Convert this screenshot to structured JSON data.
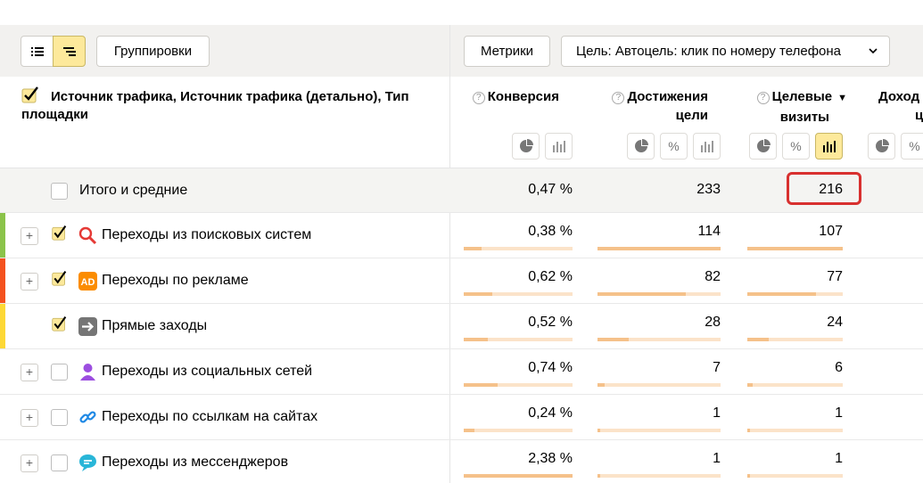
{
  "toolbar": {
    "groupings_label": "Группировки",
    "metrics_label": "Метрики",
    "goal_label": "Цель: Автоцель: клик по номеру телефона"
  },
  "header": {
    "dimension_title": "Источник трафика, Источник трафика (детально), Тип площадки",
    "columns": [
      {
        "label_line1": "Конверсия",
        "label_line2": ""
      },
      {
        "label_line1": "Достижения",
        "label_line2": "цели"
      },
      {
        "label_line1": "Целевые",
        "label_line2": "визиты",
        "sorted": "▼"
      },
      {
        "label_line1": "Доход",
        "label_line2": "ц"
      }
    ]
  },
  "total": {
    "label": "Итого и средние",
    "conversion": "0,47 %",
    "achievements": "233",
    "target_visits": "216"
  },
  "rows": [
    {
      "label": "Переходы из поисковых систем",
      "conversion": "0,38 %",
      "achievements": "114",
      "target_visits": "107",
      "stripe": "#8bc34a",
      "checked": true,
      "expandable": true,
      "icon": "search-icon",
      "conv_fill": 0.16,
      "ach_fill": 1.0,
      "tv_fill": 1.0
    },
    {
      "label": "Переходы по рекламе",
      "conversion": "0,62 %",
      "achievements": "82",
      "target_visits": "77",
      "stripe": "#f4511e",
      "checked": true,
      "expandable": true,
      "icon": "ad-icon",
      "conv_fill": 0.26,
      "ach_fill": 0.72,
      "tv_fill": 0.72
    },
    {
      "label": "Прямые заходы",
      "conversion": "0,52 %",
      "achievements": "28",
      "target_visits": "24",
      "stripe": "#fdd835",
      "checked": true,
      "expandable": false,
      "icon": "direct-arrow-icon",
      "conv_fill": 0.22,
      "ach_fill": 0.25,
      "tv_fill": 0.22
    },
    {
      "label": "Переходы из социальных сетей",
      "conversion": "0,74 %",
      "achievements": "7",
      "target_visits": "6",
      "stripe": "",
      "checked": false,
      "expandable": true,
      "icon": "social-person-icon",
      "conv_fill": 0.31,
      "ach_fill": 0.06,
      "tv_fill": 0.06
    },
    {
      "label": "Переходы по ссылкам на сайтах",
      "conversion": "0,24 %",
      "achievements": "1",
      "target_visits": "1",
      "stripe": "",
      "checked": false,
      "expandable": true,
      "icon": "link-icon",
      "conv_fill": 0.1,
      "ach_fill": 0.01,
      "tv_fill": 0.01
    },
    {
      "label": "Переходы из мессенджеров",
      "conversion": "2,38 %",
      "achievements": "1",
      "target_visits": "1",
      "stripe": "",
      "checked": false,
      "expandable": true,
      "icon": "messenger-icon",
      "conv_fill": 1.0,
      "ach_fill": 0.01,
      "tv_fill": 0.01
    }
  ],
  "colors": {
    "accent_yellow": "#fde99b",
    "highlight_red": "#d8302f",
    "bar": "#f5c18a"
  }
}
